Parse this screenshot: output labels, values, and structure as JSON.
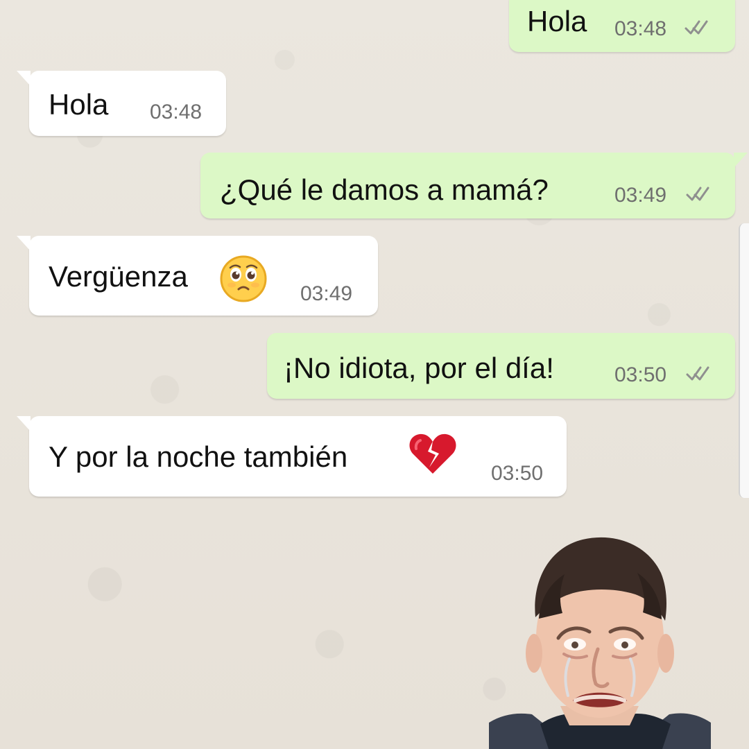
{
  "messages": [
    {
      "direction": "outgoing",
      "text": "Hola",
      "time": "03:48",
      "status_icon": "double-check-icon"
    },
    {
      "direction": "incoming",
      "text": "Hola",
      "time": "03:48"
    },
    {
      "direction": "outgoing",
      "text": "¿Qué le damos a mamá?",
      "time": "03:49",
      "status_icon": "double-check-icon"
    },
    {
      "direction": "incoming",
      "text": "Vergüenza",
      "time": "03:49",
      "emoji_icon": "pleading-face-icon"
    },
    {
      "direction": "outgoing",
      "text": "¡No idiota, por el día!",
      "time": "03:50",
      "status_icon": "double-check-icon"
    },
    {
      "direction": "incoming",
      "text": "Y por la noche también",
      "time": "03:50",
      "emoji_icon": "broken-heart-icon"
    }
  ],
  "overlay": {
    "image_subject": "crying-man-photo"
  },
  "colors": {
    "incoming_bubble": "#ffffff",
    "outgoing_bubble": "#dcf8c6",
    "chat_background": "#e8e3da",
    "time_text": "#6f6f6f"
  }
}
